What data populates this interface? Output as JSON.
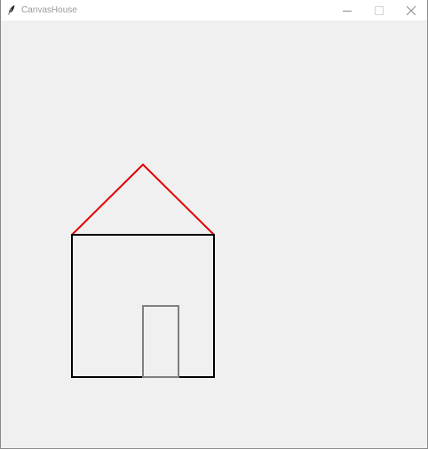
{
  "window": {
    "title": "CanvasHouse"
  },
  "icons": {
    "app": "feather-icon",
    "minimize": "minimize-icon",
    "maximize": "maximize-icon",
    "close": "close-icon"
  },
  "drawing": {
    "roof_color": "#e00000",
    "walls_color": "#000000",
    "door_color": "#808080"
  }
}
